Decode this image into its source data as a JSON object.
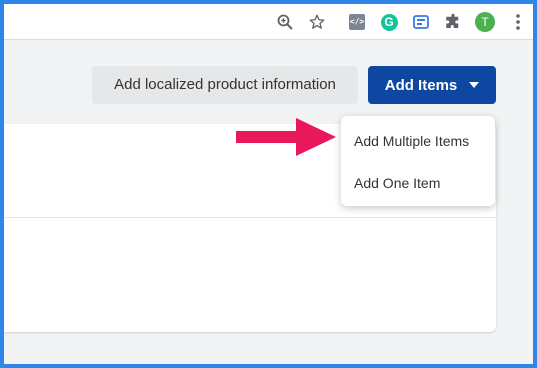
{
  "browser": {
    "icons": [
      "zoom-icon",
      "star-icon",
      "code-extension-icon",
      "grammarly-icon",
      "reader-extension-icon",
      "puzzle-icon",
      "profile-avatar",
      "more-menu-icon"
    ],
    "code_ext_label": "</>",
    "grammarly_label": "G",
    "profile_initial": "T"
  },
  "toolbar": {
    "localized_label": "Add localized product information",
    "add_items_label": "Add Items"
  },
  "dropdown": {
    "items": [
      {
        "label": "Add Multiple Items"
      },
      {
        "label": "Add One Item"
      }
    ]
  },
  "colors": {
    "frame_border": "#2f86e8",
    "primary_button": "#0d47a1",
    "annotation_arrow": "#e8185a",
    "grammarly": "#15c39a",
    "avatar": "#4caf50"
  }
}
